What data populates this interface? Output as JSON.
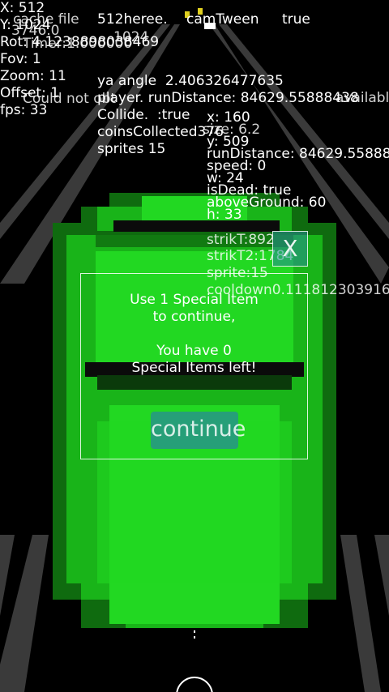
{
  "debug_left": {
    "x": "X: 512",
    "y": "Y: 1024",
    "rot": "Rot: 4.1238898038469",
    "fov": "Fov: 1",
    "zoom": "Zoom: 11",
    "offset": "Offset: 1",
    "fps": "fps: 33",
    "overlay_cache": "cache file",
    "overlay_num": "3746.0",
    "overlay_timer": "Timer:1.000000",
    "overlay_1024": "1024",
    "could_not": "Could not obt",
    "score": "512heree.",
    "score2": "1024"
  },
  "debug_center": {
    "ya_angle": "ya angle  2.406326477635",
    "player_run": "player. runDistance: 84629.55888438",
    "collide": "Collide.  :true",
    "coins": "coinsCollected376",
    "sprites": "sprites 15",
    "cam_tween": "camTween",
    "cam_tween_val": "true",
    "available": "available"
  },
  "debug_right": {
    "x": "x: 160",
    "size": "size: 6.2",
    "y": "y: 509",
    "run_distance": "runDistance: 84629.55888",
    "speed": "speed: 0",
    "w": "w: 24",
    "is_dead": "isDead: true",
    "above_ground": "aboveGround: 60",
    "h": "h: 33",
    "strik_t": "strikT:892",
    "strik_t2": "strikT2:1784",
    "sprite": "sprite:15",
    "cooldown": "cooldown0.111812303916"
  },
  "dialog": {
    "line1": "Use 1 Special Item",
    "line2": "to continue,",
    "line3": "You have 0",
    "line4": "Special Items left!",
    "continue_label": "continue",
    "close_label": "X"
  },
  "colors": {
    "background": "#000000",
    "road_lines": "#3a3a3a",
    "car_dark": "#0f6b0f",
    "car_mid": "#19b419",
    "car_light": "#22d822",
    "button": "#288c96"
  }
}
